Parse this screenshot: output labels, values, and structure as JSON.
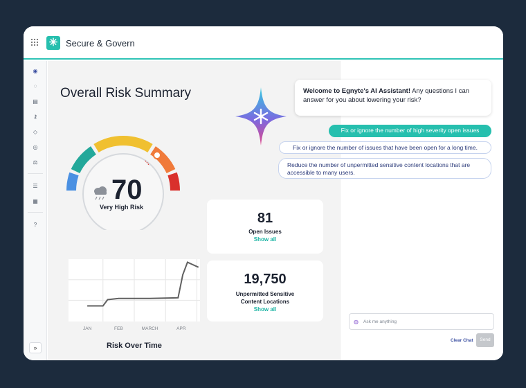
{
  "app": {
    "title": "Secure & Govern"
  },
  "sidebar": {
    "icons": [
      "dashboard-icon",
      "help-circle-icon",
      "document-icon",
      "key-icon",
      "shield-icon",
      "eye-icon",
      "scale-icon",
      "sliders-icon",
      "plugin-icon",
      "help-circle-icon"
    ]
  },
  "summary": {
    "title": "Overall Risk Summary",
    "score": "70",
    "score_label": "Very High Risk"
  },
  "cards": {
    "open_issues": {
      "value": "81",
      "label": "Open Issues",
      "link": "Show all"
    },
    "unpermitted": {
      "value": "19,750",
      "label_line1": "Unpermitted Sensitive",
      "label_line2": "Content Locations",
      "link": "Show all"
    }
  },
  "chart_data": {
    "type": "line",
    "title": "Risk Over Time",
    "x_ticks": [
      "JAN",
      "FEB",
      "MARCH",
      "APR"
    ],
    "series": [
      {
        "values": [
          {
            "x": 0.0,
            "y": 25
          },
          {
            "x": 0.5,
            "y": 25
          },
          {
            "x": 0.65,
            "y": 35
          },
          {
            "x": 1.0,
            "y": 37
          },
          {
            "x": 2.0,
            "y": 37
          },
          {
            "x": 2.9,
            "y": 38
          },
          {
            "x": 3.05,
            "y": 75
          },
          {
            "x": 3.2,
            "y": 95
          },
          {
            "x": 3.55,
            "y": 87
          }
        ]
      }
    ],
    "ylim": [
      0,
      100
    ],
    "xlim": [
      -0.6,
      3.6
    ],
    "grid": true
  },
  "assistant": {
    "welcome_bold": "Welcome to Egnyte's AI Assistant!",
    "welcome_rest": " Any questions I can answer for you about lowering your risk?",
    "suggestions": [
      "Fix or ignore the number of high severity open issues",
      "Fix or ignore the number of issues that have been open for a long time.",
      "Reduce the number of unpermitted sensitive content locations that are accessible to many users."
    ],
    "input_placeholder": "Ask me anything",
    "clear_label": "Clear Chat",
    "send_label": "Send"
  },
  "colors": {
    "accent": "#26bfae",
    "gauge": [
      "#4a90e2",
      "#23a89a",
      "#f0c030",
      "#f07a3a",
      "#d9302c"
    ]
  }
}
